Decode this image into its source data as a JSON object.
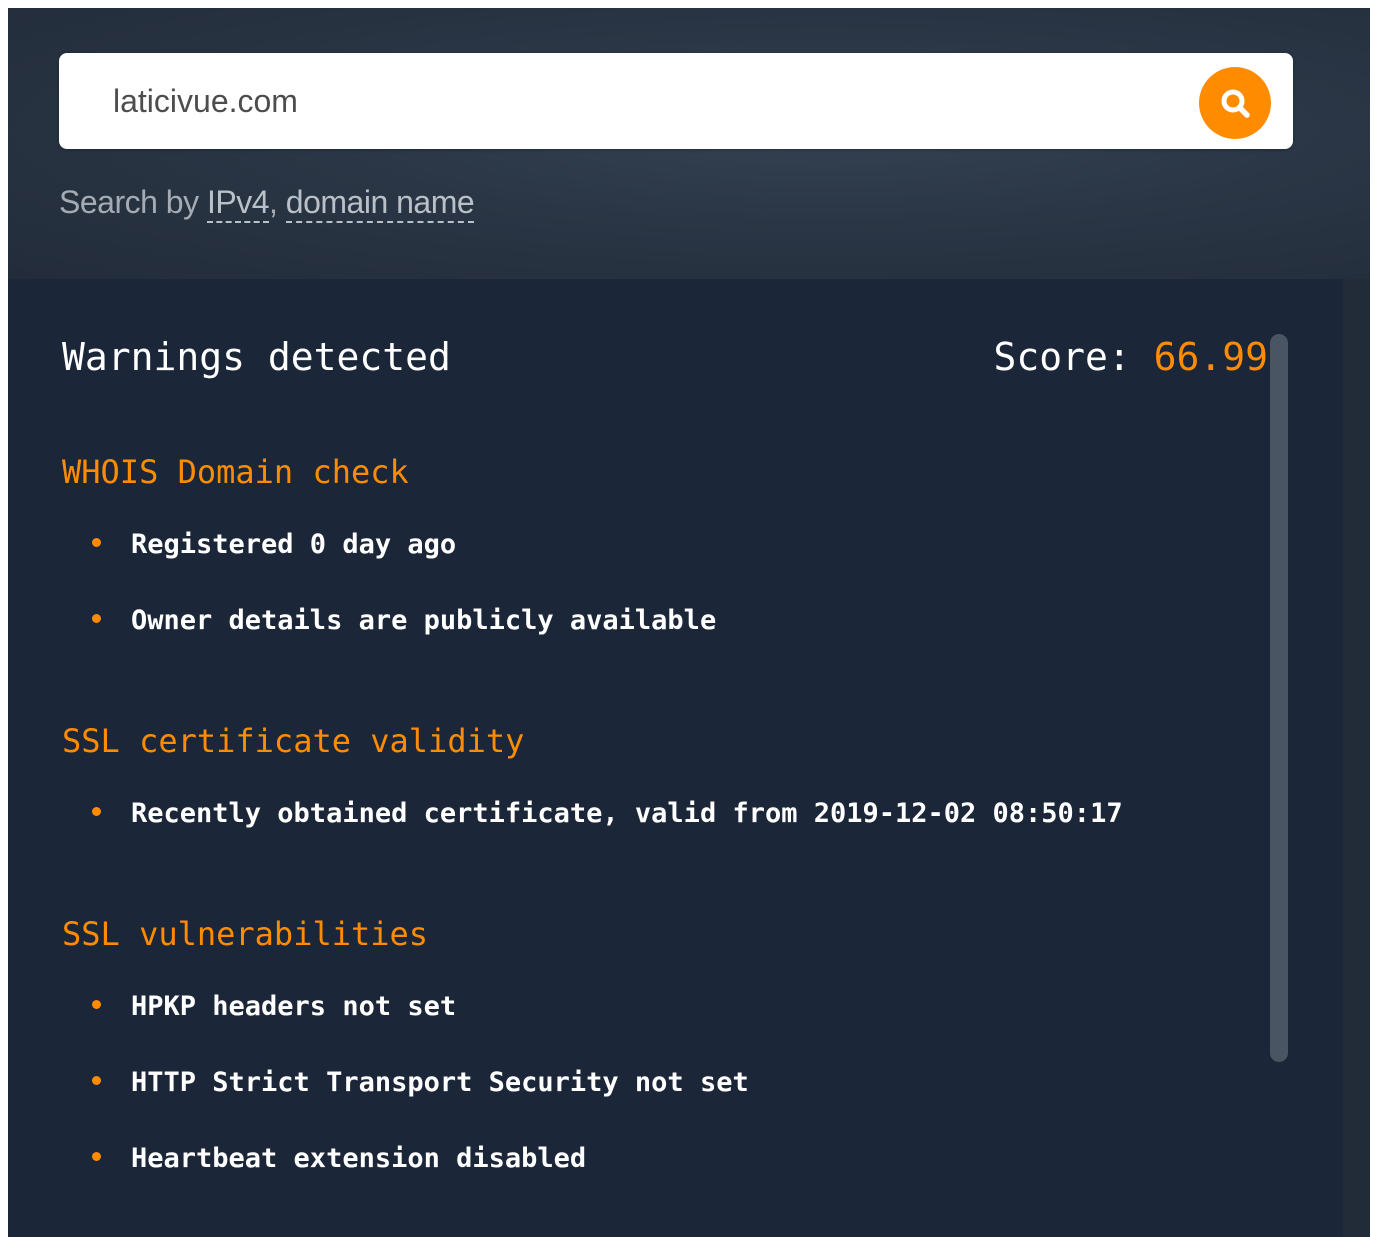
{
  "search": {
    "value": "laticivue.com",
    "button_icon": "search-icon",
    "hint_prefix": "Search by ",
    "hint_link_ipv4": "IPv4",
    "hint_separator": ", ",
    "hint_link_domain": "domain name"
  },
  "results": {
    "title": "Warnings detected",
    "score_label": "Score: ",
    "score_value": "66.99",
    "sections": [
      {
        "title": "WHOIS Domain check",
        "items": [
          "Registered 0 day ago",
          "Owner details are publicly available"
        ]
      },
      {
        "title": "SSL certificate validity",
        "items": [
          "Recently obtained certificate, valid from 2019-12-02 08:50:17"
        ]
      },
      {
        "title": "SSL vulnerabilities",
        "items": [
          "HPKP headers not set",
          "HTTP Strict Transport Security not set",
          "Heartbeat extension disabled"
        ]
      }
    ]
  },
  "colors": {
    "accent": "#ff8c00",
    "panel_background": "#1b2638",
    "text": "#ffffff",
    "hint_text": "#a4abb4"
  }
}
